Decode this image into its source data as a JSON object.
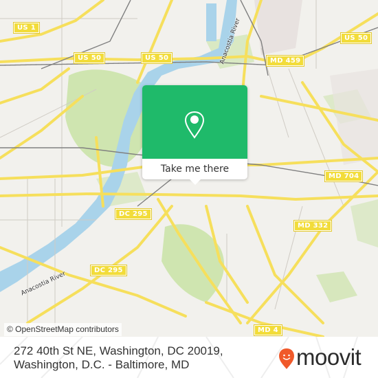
{
  "map": {
    "road_shields": [
      {
        "label": "US 1"
      },
      {
        "label": "US 50"
      },
      {
        "label": "US 50"
      },
      {
        "label": "US 50"
      },
      {
        "label": "MD 459"
      },
      {
        "label": "MD 704"
      },
      {
        "label": "MD 332"
      },
      {
        "label": "DC 295"
      },
      {
        "label": "DC 295"
      },
      {
        "label": "MD 4"
      }
    ],
    "river_labels": [
      {
        "label": "Anacostia River"
      },
      {
        "label": "Anacostia River"
      }
    ],
    "colors": {
      "land": "#f2f1ed",
      "park": "#cfe5b0",
      "water": "#a9d3ea",
      "road_major": "#f6df5c",
      "rail": "#777777",
      "shield": "#f2dc3a"
    }
  },
  "popup": {
    "icon": "location-pin-icon",
    "cta_label": "Take me there",
    "accent": "#1fba6a"
  },
  "attribution": "© OpenStreetMap contributors",
  "footer": {
    "address": "272 40th St NE, Washington, DC 20019, Washington, D.C. - Baltimore, MD",
    "brand": "moovit",
    "brand_color": "#f0592a"
  }
}
